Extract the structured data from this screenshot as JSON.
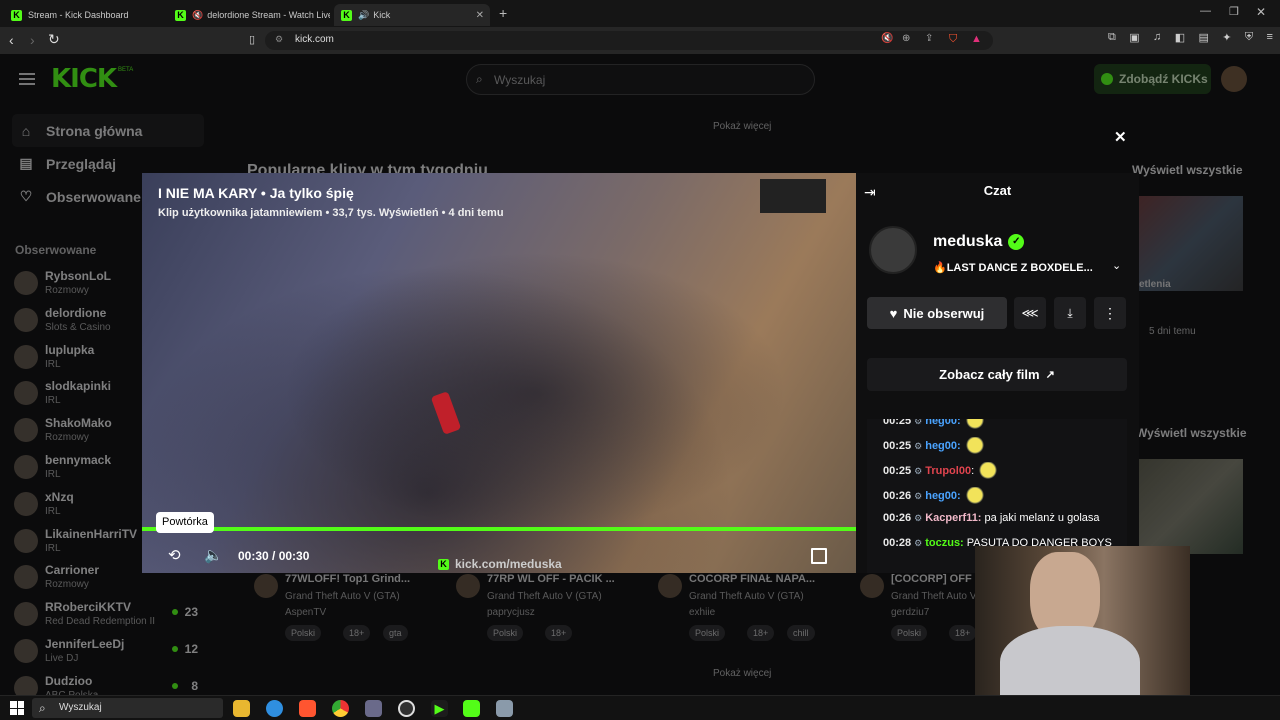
{
  "browser": {
    "tabs": [
      {
        "title": "Stream - Kick Dashboard"
      },
      {
        "title": "delordione Stream - Watch Live o"
      },
      {
        "title": "Kick"
      }
    ],
    "url": "kick.com"
  },
  "site": {
    "logo": "KICK",
    "logo_badge": "BETA",
    "search_placeholder": "Wyszukaj",
    "get_kicks": "Zdobądź KICKs",
    "nav": {
      "home": "Strona główna",
      "browse": "Przeglądaj",
      "following": "Obserwowane"
    },
    "followed_heading": "Obserwowane",
    "followed": [
      {
        "name": "RybsonLoL",
        "category": "Rozmowy",
        "viewers": ""
      },
      {
        "name": "delordione",
        "category": "Slots & Casino",
        "viewers": ""
      },
      {
        "name": "luplupka",
        "category": "IRL",
        "viewers": ""
      },
      {
        "name": "slodkapinki",
        "category": "IRL",
        "viewers": ""
      },
      {
        "name": "ShakoMako",
        "category": "Rozmowy",
        "viewers": ""
      },
      {
        "name": "bennymack",
        "category": "IRL",
        "viewers": ""
      },
      {
        "name": "xNzq",
        "category": "IRL",
        "viewers": ""
      },
      {
        "name": "LikainenHarriTV",
        "category": "IRL",
        "viewers": ""
      },
      {
        "name": "Carrioner",
        "category": "Rozmowy",
        "viewers": ""
      },
      {
        "name": "RRoberciKKTV",
        "category": "Red Dead Redemption II",
        "viewers": "23"
      },
      {
        "name": "JenniferLeeDj",
        "category": "Live DJ",
        "viewers": "12"
      },
      {
        "name": "Dudzioo",
        "category": "ABC Polska",
        "viewers": "8"
      }
    ],
    "show_more": "Pokaż więcej",
    "clips_heading": "Popularne klipy w tym tygodniu",
    "view_all": "Wyświetl wszystkie",
    "side_card_text": "etlenia",
    "side_card_age": "5 dni temu",
    "bottom_cards": [
      {
        "title": "77WLOFF! Top1 Grind...",
        "game": "Grand Theft Auto V (GTA)",
        "streamer": "AspenTV",
        "tags": [
          "Polski",
          "18+",
          "gta"
        ]
      },
      {
        "title": "77RP WL OFF - PACIK ...",
        "game": "Grand Theft Auto V (GTA)",
        "streamer": "paprycjusz",
        "tags": [
          "Polski",
          "18+"
        ]
      },
      {
        "title": "COCORP FINAŁ NAPA...",
        "game": "Grand Theft Auto V (GTA)",
        "streamer": "exhiie",
        "tags": [
          "Polski",
          "18+",
          "chill"
        ]
      },
      {
        "title": "[COCORP] OFF",
        "game": "Grand Theft Auto V (GTA)",
        "streamer": "gerdziu7",
        "tags": [
          "Polski",
          "18+"
        ]
      }
    ]
  },
  "clip": {
    "title": "I NIE MA KARY • Ja tylko śpię",
    "subtitle": "Klip użytkownika jatamniewiem • 33,7 tys. Wyświetleń • 4 dni temu",
    "watermark": "kick.com/meduska",
    "time": "00:30 / 00:30",
    "progress": 1.0,
    "tooltip": "Powtórka"
  },
  "chat": {
    "title": "Czat",
    "channel": "meduska",
    "stream_title": "🔥LAST DANCE Z BOXDELE...",
    "unfollow": "Nie obserwuj",
    "watch_full": "Zobacz cały film",
    "messages": [
      {
        "time": "00:25",
        "user": "heg00:",
        "text": "",
        "color": "#4aa3ff",
        "emote": true
      },
      {
        "time": "00:25",
        "user": "heg00:",
        "text": "",
        "color": "#4aa3ff",
        "emote": true
      },
      {
        "time": "00:25",
        "user": "Trupol00",
        "text": ":",
        "color": "#e0444e",
        "emote": true
      },
      {
        "time": "00:26",
        "user": "heg00:",
        "text": "",
        "color": "#4aa3ff",
        "emote": true
      },
      {
        "time": "00:26",
        "user": "Kacperf11:",
        "text": " pa jaki melanż u golasa",
        "color": "#f0b8c8",
        "emote": false
      },
      {
        "time": "00:28",
        "user": "toczus:",
        "text": " PASUTA DO DANGER BOYS",
        "color": "#53fc18",
        "emote": false
      }
    ]
  },
  "taskbar": {
    "search": "Wyszukaj"
  },
  "colors": {
    "accent": "#53fc18",
    "background": "#0b0b0c"
  }
}
